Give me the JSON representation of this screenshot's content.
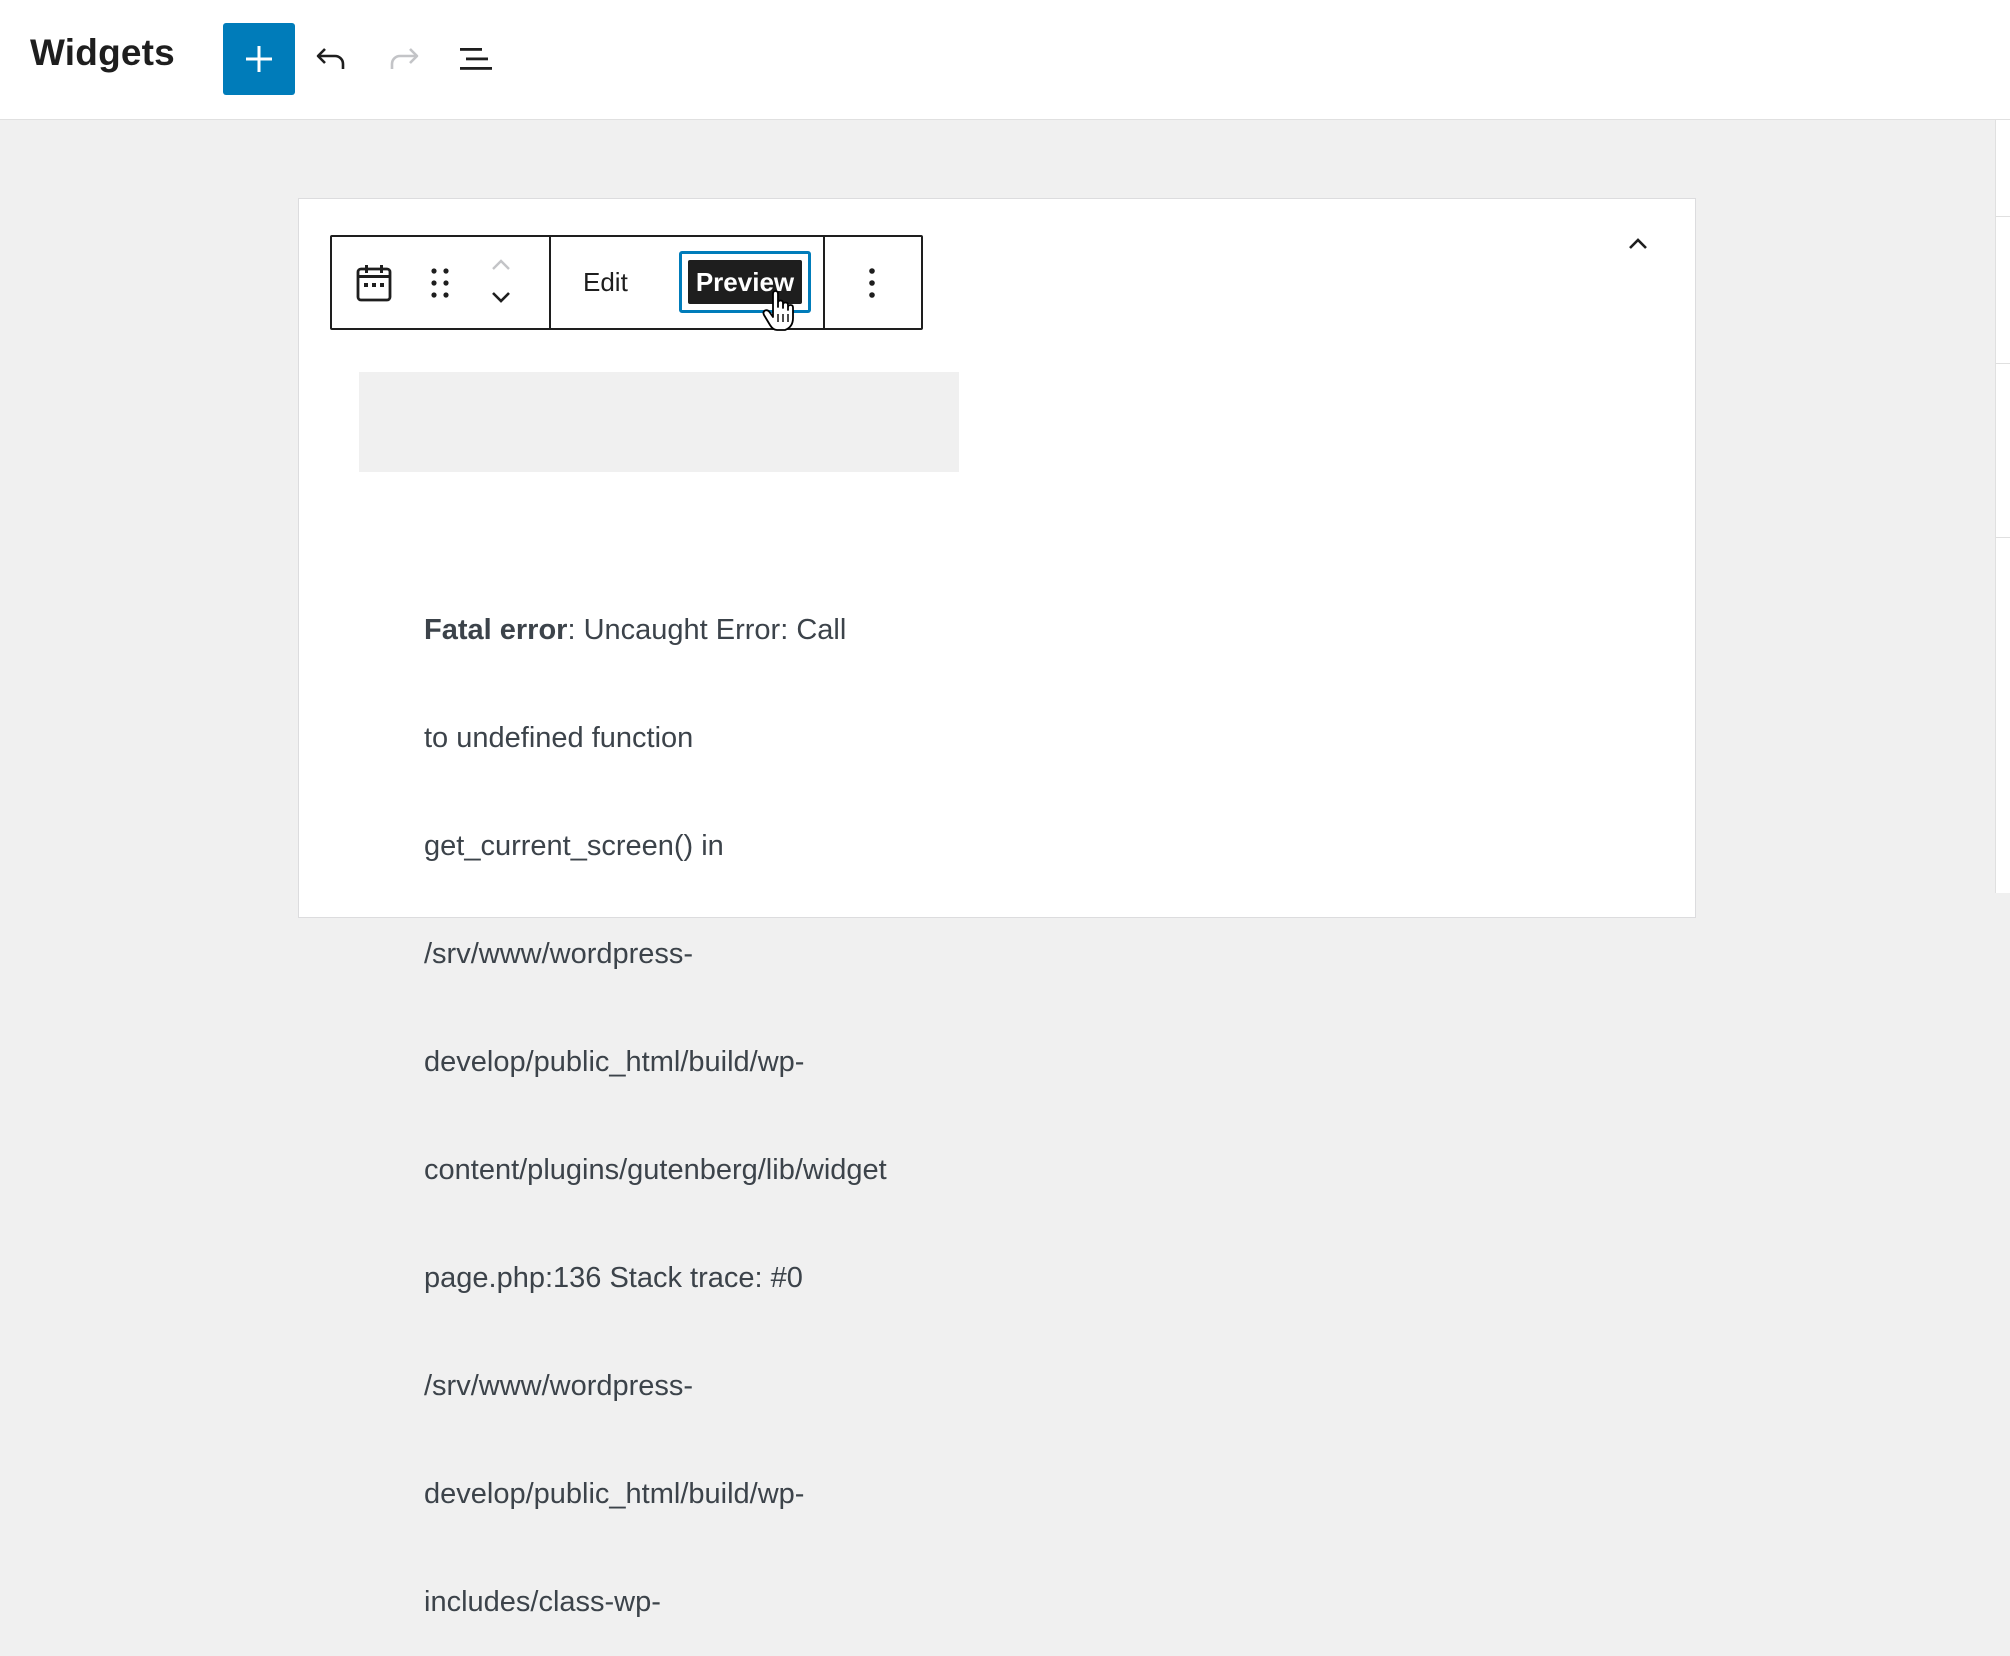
{
  "header": {
    "title": "Widgets",
    "inserter_icon": "plus-icon",
    "undo_icon": "undo-icon",
    "redo_icon": "redo-icon",
    "list_view_icon": "list-view-icon"
  },
  "block_toolbar": {
    "block_icon": "calendar-icon",
    "drag_icon": "drag-handle-icon",
    "move_up_icon": "chevron-up-icon",
    "move_down_icon": "chevron-down-icon",
    "edit_label": "Edit",
    "preview_label": "Preview",
    "options_icon": "more-vertical-icon"
  },
  "widget_area": {
    "collapse_icon": "chevron-up-icon"
  },
  "error": {
    "strong": "Fatal error",
    "lines": [
      ": Uncaught Error: Call",
      "to undefined function",
      "get_current_screen() in",
      "/srv/www/wordpress-",
      "develop/public_html/build/wp-",
      "content/plugins/gutenberg/lib/widget",
      "page.php:136 Stack trace: #0",
      "/srv/www/wordpress-",
      "develop/public_html/build/wp-",
      "includes/class-wp-"
    ]
  },
  "colors": {
    "accent": "#007cba",
    "dark": "#1e1e1e",
    "canvas": "#f0f0f0"
  }
}
